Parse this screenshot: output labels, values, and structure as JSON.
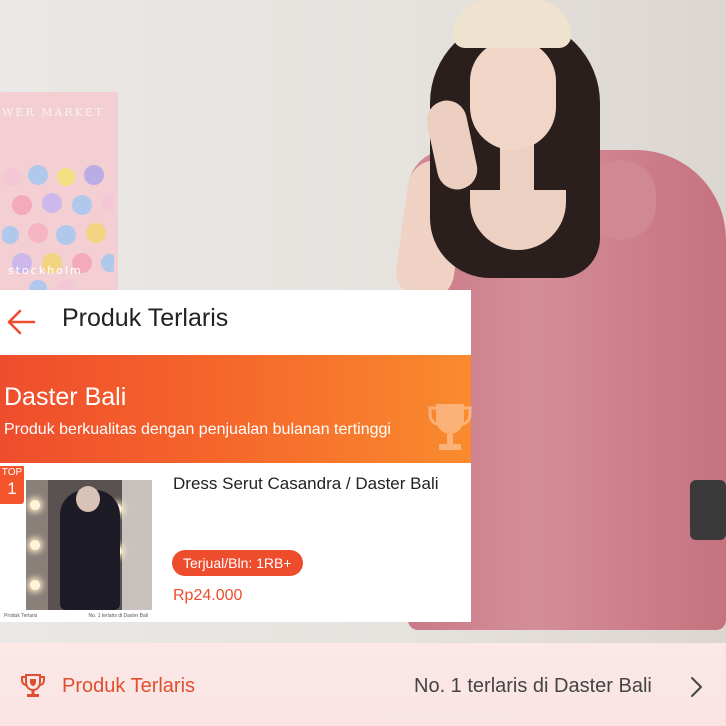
{
  "poster": {
    "title": "WER MARKET",
    "footer": "stockholm"
  },
  "header": {
    "title": "Produk Terlaris",
    "back_icon": "arrow-left-icon"
  },
  "banner": {
    "title": "Daster Bali",
    "subtitle": "Produk berkualitas dengan penjualan bulanan tertinggi",
    "icon": "trophy-icon"
  },
  "product": {
    "badge_top": "TOP",
    "badge_rank": "1",
    "name": "Dress Serut Casandra / Daster Bali",
    "sold": "Terjual/Bln: 1RB+",
    "price": "Rp24.000",
    "thumb_caption_left": "Produk Terlaris",
    "thumb_caption_right": "No. 1 terlaris di Daster Bali"
  },
  "bottom_bar": {
    "label": "Produk Terlaris",
    "rank_text": "No. 1 terlaris di Daster Bali",
    "icon": "trophy-icon",
    "chevron": "chevron-right-icon"
  },
  "colors": {
    "accent": "#ee4d2d",
    "banner_end": "#f98b2e",
    "bar_bg": "#fbe8e7"
  }
}
